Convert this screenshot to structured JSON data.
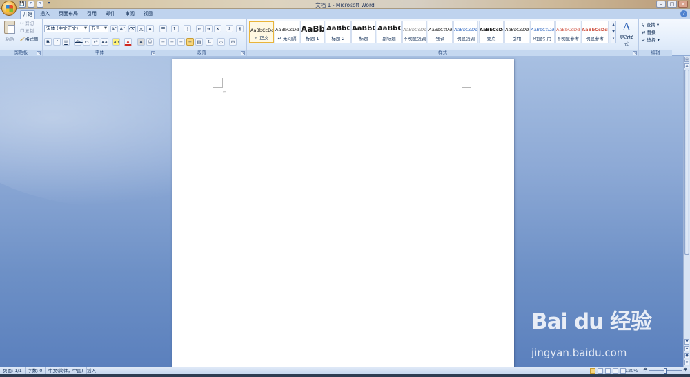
{
  "window": {
    "title": "文档 1 - Microsoft Word",
    "controls": {
      "minimize": "–",
      "maximize": "□",
      "close": "×"
    }
  },
  "quick_access": {
    "save": "💾",
    "undo": "↶",
    "redo": "↷",
    "customize": "▾"
  },
  "tabs": [
    {
      "label": "开始"
    },
    {
      "label": "插入"
    },
    {
      "label": "页面布局"
    },
    {
      "label": "引用"
    },
    {
      "label": "邮件"
    },
    {
      "label": "审阅"
    },
    {
      "label": "视图"
    }
  ],
  "ribbon": {
    "clipboard": {
      "label": "剪贴板",
      "paste": "粘贴",
      "cut": "剪切",
      "copy": "复制",
      "format_painter": "格式刷"
    },
    "font": {
      "label": "字体",
      "font_name": "宋体 (中文正文)",
      "font_size": "五号"
    },
    "paragraph": {
      "label": "段落"
    },
    "styles": {
      "label": "样式",
      "items": [
        {
          "sample": "AaBbCcDd",
          "name": "↵ 正文"
        },
        {
          "sample": "AaBbCcDd",
          "name": "↵ 无间隔"
        },
        {
          "sample": "AaBb",
          "name": "标题 1"
        },
        {
          "sample": "AaBbC",
          "name": "标题 2"
        },
        {
          "sample": "AaBbC",
          "name": "标题"
        },
        {
          "sample": "AaBbC",
          "name": "副标题"
        },
        {
          "sample": "AaBbCcDd",
          "name": "不明显强调"
        },
        {
          "sample": "AaBbCcDd",
          "name": "强调"
        },
        {
          "sample": "AaBbCcDd",
          "name": "明显强调"
        },
        {
          "sample": "AaBbCcDd",
          "name": "要点"
        },
        {
          "sample": "AaBbCcDd",
          "name": "引用"
        },
        {
          "sample": "AaBbCcDd",
          "name": "明显引用"
        },
        {
          "sample": "AaBbCcDd",
          "name": "不明显参考"
        },
        {
          "sample": "AaBbCcDd",
          "name": "明显参考"
        }
      ],
      "change_styles": "更改样式"
    },
    "editing": {
      "label": "编辑",
      "find": "查找",
      "replace": "替换",
      "select": "选择"
    }
  },
  "document": {
    "paragraph_mark": "↵"
  },
  "statusbar": {
    "page": "页面: 1/1",
    "words": "字数: 0",
    "language": "中文(简体，中国)",
    "mode": "插入",
    "zoom": "120%"
  },
  "watermark": {
    "logo": "Bai du 经验",
    "url": "jingyan.baidu.com"
  }
}
